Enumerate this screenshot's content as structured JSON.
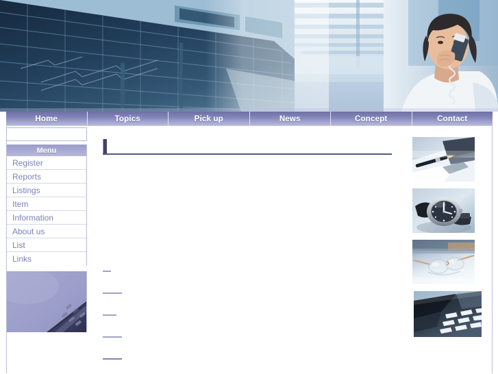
{
  "site": {
    "title": "Corporate Business Template",
    "accent_dark": "#3f4468",
    "accent_nav_top": "#6f6fa4",
    "accent_nav_bottom": "#b9bcdc",
    "menu_text_color": "#7b82b8",
    "border_color": "#b8bada"
  },
  "banner": {
    "alt": "Glass office building exterior, bright atrium skylights, and a businesswoman talking on a telephone",
    "regions": [
      {
        "name": "glass-office-building",
        "description": "Low angle view of a modern blue glass curtain wall building"
      },
      {
        "name": "atrium-skylight-ceiling",
        "description": "Bright white interior ceiling with slatted skylights"
      },
      {
        "name": "businesswoman-on-phone",
        "description": "Woman holding a corded telephone handset to her ear"
      }
    ]
  },
  "nav": {
    "items": [
      {
        "label": "Home"
      },
      {
        "label": "Topics"
      },
      {
        "label": "Pick up"
      },
      {
        "label": "News"
      },
      {
        "label": "Concept"
      },
      {
        "label": "Contact"
      }
    ]
  },
  "sidebar": {
    "search": {
      "value": "",
      "placeholder": ""
    },
    "menu_heading": "Menu",
    "items": [
      {
        "label": "Register"
      },
      {
        "label": "Reports"
      },
      {
        "label": "Listings"
      },
      {
        "label": "Item"
      },
      {
        "label": "Information"
      },
      {
        "label": "About us"
      },
      {
        "label": "List"
      },
      {
        "label": "Links"
      }
    ],
    "photo": {
      "name": "keyboard-photo",
      "alt": "Corner of a computer keyboard on a lavender tinted background"
    }
  },
  "main": {
    "heading": "",
    "body": "",
    "links": [
      {
        "label": "",
        "width_class": "w1"
      },
      {
        "label": "",
        "width_class": "w2"
      },
      {
        "label": "",
        "width_class": "w3"
      },
      {
        "label": "",
        "width_class": "w4"
      },
      {
        "label": "",
        "width_class": "w5"
      }
    ]
  },
  "right_column": {
    "photos": [
      {
        "name": "pen-and-notebook-photo",
        "alt": "Fountain pen resting on an open notebook beside a planner"
      },
      {
        "name": "wristwatch-photo",
        "alt": "Men's wristwatch lying on a desk"
      },
      {
        "name": "eyeglasses-photo",
        "alt": "Pair of rimless eyeglasses resting on a document"
      },
      {
        "name": "telephone-keypad-photo",
        "alt": "Close up of a black office telephone keypad"
      }
    ]
  }
}
